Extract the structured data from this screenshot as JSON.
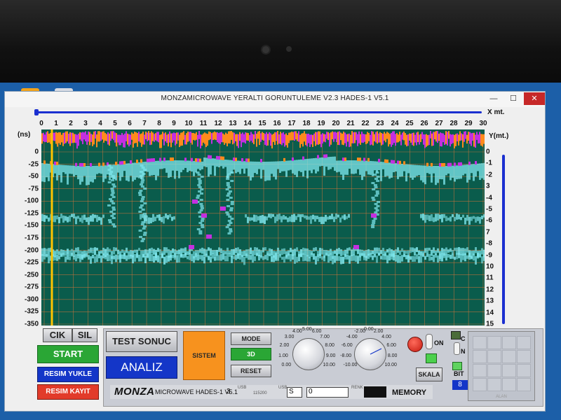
{
  "window": {
    "title": "MONZAMICROWAVE YERALTI GORUNTULEME V2.3 HADES-1 V5.1",
    "min_glyph": "—",
    "max_glyph": "☐",
    "close_glyph": "✕"
  },
  "plot": {
    "x_unit": "X mt.",
    "y_left_unit": "(ns)",
    "y_right_unit": "Y(mt.)",
    "x_ticks": [
      "0",
      "1",
      "2",
      "3",
      "4",
      "5",
      "6",
      "7",
      "8",
      "9",
      "10",
      "11",
      "12",
      "13",
      "14",
      "15",
      "16",
      "17",
      "18",
      "19",
      "20",
      "21",
      "22",
      "23",
      "24",
      "25",
      "26",
      "27",
      "28",
      "29",
      "30"
    ],
    "ns_ticks": [
      "0",
      "-25",
      "-50",
      "-75",
      "-100",
      "-125",
      "-150",
      "-175",
      "-200",
      "-225",
      "-250",
      "-275",
      "-300",
      "-325",
      "-350"
    ],
    "m_ticks": [
      "0",
      "-1",
      "-2",
      "3",
      "-4",
      "-5",
      "-6",
      "7",
      "-8",
      "-9",
      "10",
      "11",
      "12",
      "13",
      "14",
      "15"
    ],
    "colors": {
      "background": "#0a5c4c",
      "grid": "#d9763a",
      "surface_magenta": "#c42fe0",
      "surface_orange": "#ff8a1c",
      "reflection_cyan": "#7fe8ef",
      "marker_yellow": "#ffc400",
      "axis_blue": "#1a2fd0"
    }
  },
  "buttons": {
    "cik": "CIK",
    "sil": "SIL",
    "start": "START",
    "resim_yukle": "RESIM YUKLE",
    "resim_kayit": "RESIM KAYIT",
    "test_sonuc": "TEST SONUC",
    "analiz": "ANALIZ",
    "sistem": "SISTEM",
    "mode": "MODE",
    "mode_3d": "3D",
    "reset": "RESET",
    "skala": "SKALA"
  },
  "dials": {
    "left": [
      "0.00",
      "1.00",
      "2.00",
      "3.00",
      "4.00",
      "5.00",
      "6.00",
      "7.00",
      "8.00",
      "9.00",
      "10.00"
    ],
    "right": [
      "-10.00",
      "-8.00",
      "-6.00",
      "-4.00",
      "-2.00",
      "0.00",
      "2.00",
      "4.00",
      "6.00",
      "8.00",
      "10.00"
    ]
  },
  "toggles": {
    "on_label": "ON",
    "c_label": "C",
    "n_label": "N",
    "bit_label": "BIT",
    "bit_value": "8"
  },
  "status": {
    "logo": "MONZA",
    "product": "MICROWAVE HADES-1 V5.1",
    "port_value": "3",
    "usb_label": "USB",
    "baud_value": "115200",
    "usb_label2": "USB",
    "s_value": "S",
    "zero_value": "0",
    "renk_label": "RENK",
    "memory": "MEMORY"
  },
  "grid_panel": {
    "caption": "ALAN"
  }
}
